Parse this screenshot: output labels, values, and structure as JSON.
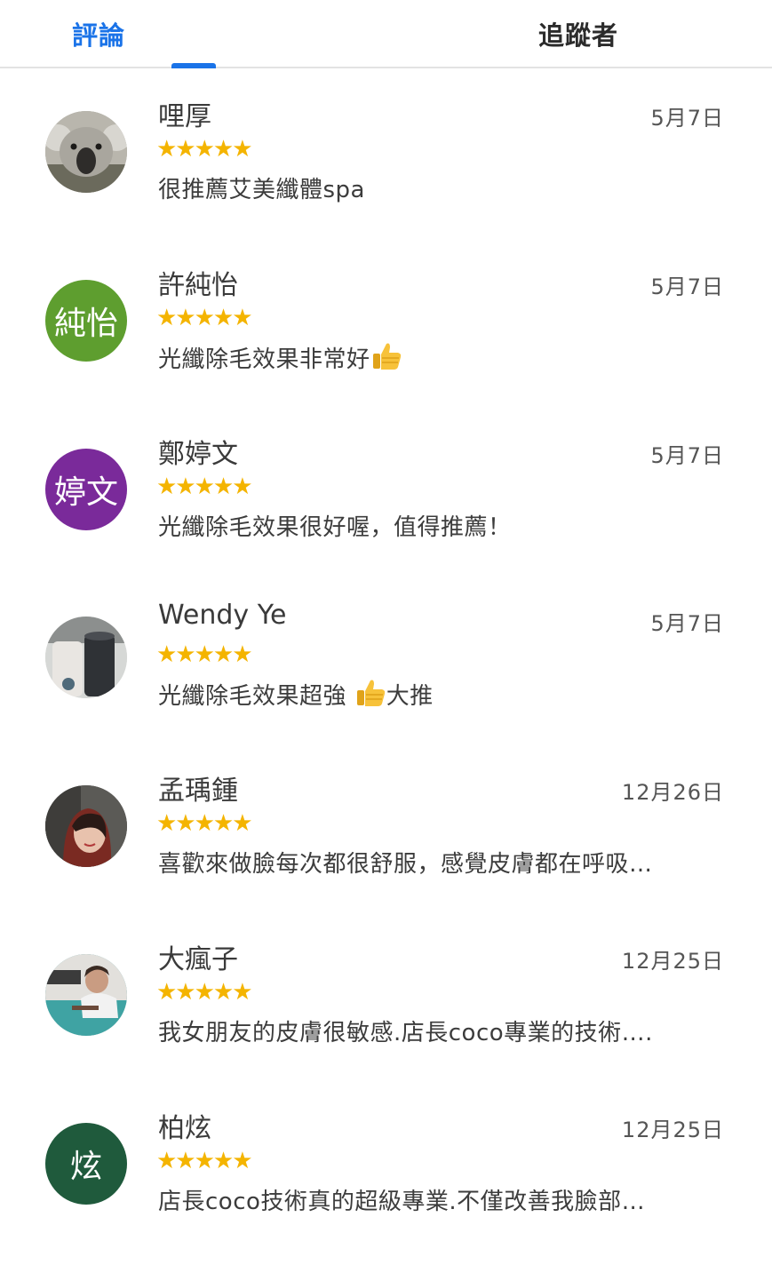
{
  "tabs": [
    {
      "label": "評論",
      "active": true
    },
    {
      "label": "追蹤者",
      "active": false
    }
  ],
  "colors": {
    "accent": "#1a73e8",
    "star": "#f4b400"
  },
  "rating_max": 5,
  "reviews": [
    {
      "name": "哩厚",
      "date": "5月7日",
      "rating": 5,
      "stars": "★★★★★",
      "text": "很推薦艾美纖體spa",
      "avatar": {
        "type": "photo",
        "subject": "koala"
      }
    },
    {
      "name": "許純怡",
      "date": "5月7日",
      "rating": 5,
      "stars": "★★★★★",
      "text": "光纖除毛效果非常好",
      "emoji": "thumbs-up",
      "avatar": {
        "type": "initials",
        "initials": "純怡",
        "color": "#5e9e2f"
      }
    },
    {
      "name": "鄭婷文",
      "date": "5月7日",
      "rating": 5,
      "stars": "★★★★★",
      "text": "光纖除毛效果很好喔，值得推薦！",
      "avatar": {
        "type": "initials",
        "initials": "婷文",
        "color": "#7a2a9a"
      }
    },
    {
      "name": "Wendy Ye",
      "date": "5月7日",
      "rating": 5,
      "stars": "★★★★★",
      "text": "光纖除毛效果超強",
      "text_after_emoji": "大推",
      "emoji": "thumbs-up",
      "avatar": {
        "type": "photo",
        "subject": "coffee cups"
      }
    },
    {
      "name": "孟瑀鍾",
      "date": "12月26日",
      "rating": 5,
      "stars": "★★★★★",
      "text": "喜歡來做臉每次都很舒服，感覺皮膚都在呼吸…",
      "avatar": {
        "type": "photo",
        "subject": "person selfie"
      }
    },
    {
      "name": "大瘋子",
      "date": "12月25日",
      "rating": 5,
      "stars": "★★★★★",
      "text": "我女朋友的皮膚很敏感.店長coco專業的技術….",
      "avatar": {
        "type": "photo",
        "subject": "person at pool"
      }
    },
    {
      "name": "柏炫",
      "date": "12月25日",
      "rating": 5,
      "stars": "★★★★★",
      "text": "店長coco技術真的超級專業.不僅改善我臉部…",
      "avatar": {
        "type": "initials",
        "initials": "炫",
        "color": "#1f5a3c"
      }
    }
  ]
}
